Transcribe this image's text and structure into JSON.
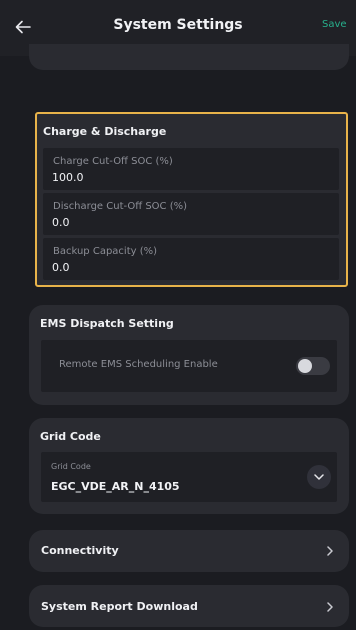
{
  "header": {
    "title": "System Settings",
    "save_label": "Save"
  },
  "charge_discharge": {
    "title": "Charge & Discharge",
    "fields": [
      {
        "label": "Charge Cut-Off SOC (%)",
        "value": "100.0"
      },
      {
        "label": "Discharge Cut-Off SOC (%)",
        "value": "0.0"
      },
      {
        "label": "Backup Capacity (%)",
        "value": "0.0"
      }
    ]
  },
  "ems": {
    "title": "EMS Dispatch Setting",
    "toggle_label": "Remote EMS Scheduling Enable",
    "toggle_on": false
  },
  "grid_code": {
    "title": "Grid Code",
    "field_label": "Grid Code",
    "value": "EGC_VDE_AR_N_4105"
  },
  "connectivity": {
    "label": "Connectivity"
  },
  "system_report": {
    "label": "System Report Download"
  },
  "colors": {
    "background": "#1b1c21",
    "card": "#2a2b31",
    "accent": "#27b08c",
    "highlight": "#e8b34a"
  }
}
